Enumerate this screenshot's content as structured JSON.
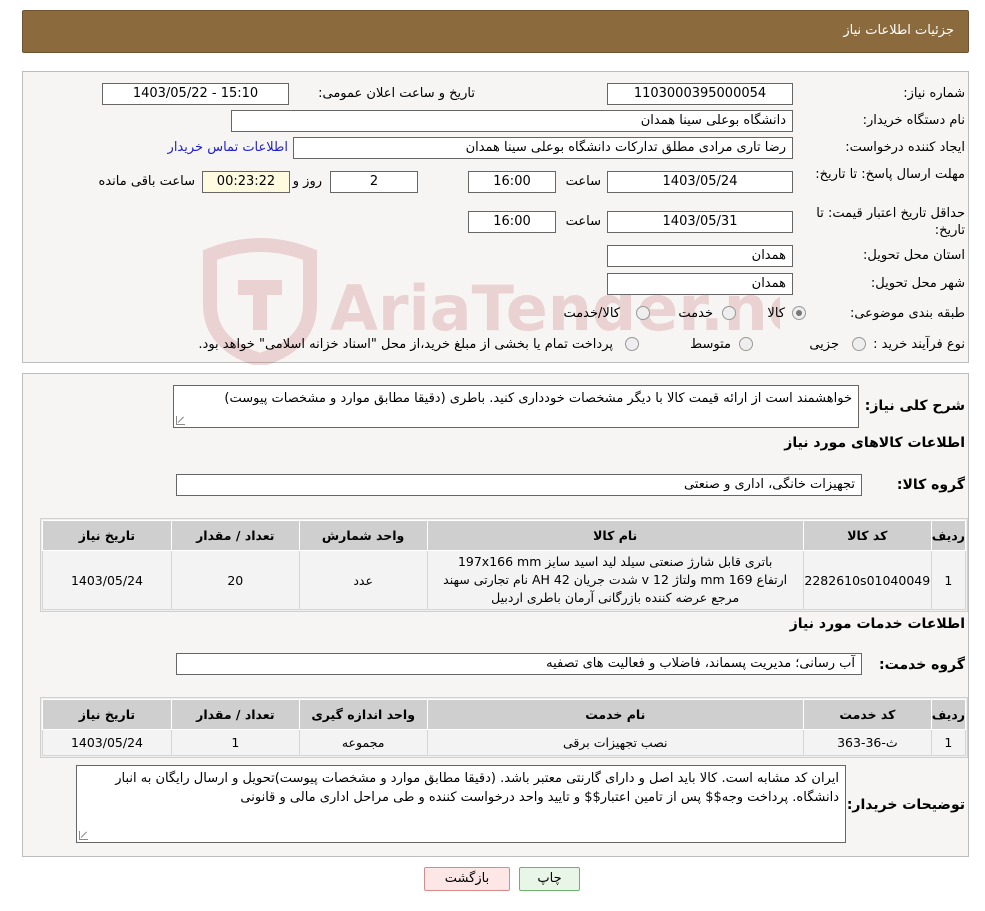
{
  "header": {
    "title": "جزئیات اطلاعات نیاز"
  },
  "info": {
    "need_number_label": "شماره نیاز:",
    "need_number": "1103000395000054",
    "announce_label": "تاریخ و ساعت اعلان عمومی:",
    "announce_value": "1403/05/22 - 15:10",
    "buyer_label": "نام دستگاه خریدار:",
    "buyer_value": "دانشگاه بوعلی سینا همدان",
    "creator_label": "ایجاد کننده درخواست:",
    "creator_value": "رضا تاری مرادی مطلق تدارکات دانشگاه بوعلی سینا همدان",
    "contact_link": "اطلاعات تماس خریدار",
    "reply_deadline_label": "مهلت ارسال پاسخ: تا تاریخ:",
    "reply_date": "1403/05/24",
    "time_label": "ساعت",
    "reply_time": "16:00",
    "days_value": "2",
    "days_label": "روز و",
    "remaining_time": "00:23:22",
    "remaining_label": "ساعت باقی مانده",
    "validity_label": "حداقل تاریخ اعتبار قیمت: تا تاریخ:",
    "validity_date": "1403/05/31",
    "validity_time_label": "ساعت",
    "validity_time": "16:00",
    "province_label": "استان محل تحویل:",
    "province_value": "همدان",
    "city_label": "شهر محل تحویل:",
    "city_value": "همدان",
    "category_label": "طبقه بندی موضوعی:",
    "category_options": [
      "کالا",
      "خدمت",
      "کالا/خدمت"
    ],
    "category_selected": "کالا",
    "process_label": "نوع فرآیند خرید :",
    "process_options": [
      "جزیی",
      "متوسط"
    ],
    "process_note": "پرداخت تمام یا بخشی از مبلغ خرید،از محل \"اسناد خزانه اسلامی\" خواهد بود."
  },
  "watermark": {
    "text": "AriaTender.neT"
  },
  "details": {
    "summary_label": "شرح کلی نیاز:",
    "summary_text": "خواهشمند است از ارائه قیمت کالا با دیگر مشخصات خودداری کنید.  باطری    (دقیقا مطابق موارد و مشخصات پیوست)",
    "goods_section_title": "اطلاعات کالاهای مورد نیاز",
    "goods_group_label": "گروه کالا:",
    "goods_group_value": "تجهیزات خانگی، اداری و صنعتی",
    "goods_table": {
      "headers": [
        "ردیف",
        "کد کالا",
        "نام کالا",
        "واحد شمارش",
        "تعداد / مقدار",
        "تاریخ نیاز"
      ],
      "rows": [
        {
          "row": "1",
          "code": "2282610s01040049",
          "name_line1": "باتری قابل شارژ صنعتی سیلد لید اسید سایز 197x166 mm",
          "name_line2": "ارتفاع 169 mm ولتاژ 12 v شدت جریان 42 AH نام تجارتی سهند",
          "name_line3": "مرجع عرضه کننده بازرگانی آرمان باطری اردبیل",
          "unit": "عدد",
          "qty": "20",
          "date": "1403/05/24"
        }
      ]
    },
    "services_section_title": "اطلاعات خدمات مورد نیاز",
    "service_group_label": "گروه خدمت:",
    "service_group_value": "آب رسانی؛ مدیریت پسماند، فاضلاب و فعالیت های تصفیه",
    "services_table": {
      "headers": [
        "ردیف",
        "کد خدمت",
        "نام خدمت",
        "واحد اندازه گیری",
        "تعداد / مقدار",
        "تاریخ نیاز"
      ],
      "rows": [
        {
          "row": "1",
          "code": "ث-36-363",
          "name": "نصب تجهیزات برقی",
          "unit": "مجموعه",
          "qty": "1",
          "date": "1403/05/24"
        }
      ]
    },
    "buyer_notes_label": "توضیحات خریدار:",
    "buyer_notes_text": "ایران کد مشابه است. کالا باید اصل و دارای گارنتی معتبر باشد. (دقیقا مطابق موارد و مشخصات پیوست)تحویل و ارسال رایگان به انبار دانشگاه. پرداخت وجه$$ پس از تامین اعتبار$$ و تایید واحد درخواست کننده و طی مراحل اداری مالی و قانونی"
  },
  "buttons": {
    "print": "چاپ",
    "back": "بازگشت"
  }
}
